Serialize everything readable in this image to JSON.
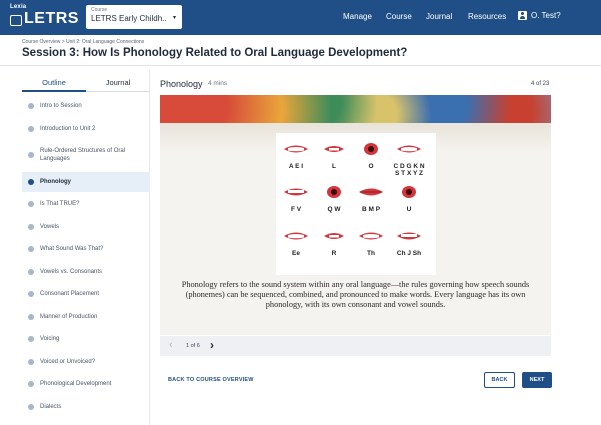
{
  "brand": {
    "small": "Lexia",
    "main": "LETRS"
  },
  "course_select": {
    "label": "Course",
    "value": "LETRS Early Childh...",
    "caret": "▾"
  },
  "nav": {
    "manage": "Manage",
    "course": "Course",
    "journal": "Journal",
    "resources": "Resources",
    "user": "O. Test?"
  },
  "breadcrumb": "Course Overview > Unit 2: Oral Language Connections",
  "page_title": "Session 3:  How Is Phonology Related to Oral Language Development?",
  "sidebar": {
    "tabs": {
      "outline": "Outline",
      "journal": "Journal"
    },
    "items": [
      {
        "label": "Intro to Session"
      },
      {
        "label": "Introduction to Unit 2"
      },
      {
        "label": "Rule-Ordered Structures of Oral Languages"
      },
      {
        "label": "Phonology"
      },
      {
        "label": "Is That TRUE?"
      },
      {
        "label": "Vowels"
      },
      {
        "label": "What Sound Was That?"
      },
      {
        "label": "Vowels vs. Consonants"
      },
      {
        "label": "Consonant Placement"
      },
      {
        "label": "Manner of Production"
      },
      {
        "label": "Voicing"
      },
      {
        "label": "Voiced or Unvoiced?"
      },
      {
        "label": "Phonological Development"
      },
      {
        "label": "Dialects"
      }
    ],
    "active_index": 3
  },
  "panel": {
    "title": "Phonology",
    "duration": "4 mins",
    "page": "4 of 23"
  },
  "slide": {
    "mouth_labels": [
      "A E I",
      "L",
      "O",
      "C D G K N\nS T X Y Z",
      "F V",
      "Q W",
      "B M P",
      "U",
      "Ee",
      "R",
      "Th",
      "Ch J Sh"
    ],
    "caption": "Phonology refers to the sound system within any oral language—the rules governing how speech sounds (phonemes) can be sequenced, combined, and pronounced to make words. Every language has its own phonology, with its own consonant and vowel sounds."
  },
  "pager": {
    "prev": "‹",
    "count": "1 of 6",
    "next": "›"
  },
  "footer": {
    "back_link": "BACK TO COURSE OVERVIEW",
    "back_button": "BACK",
    "next_button": "NEXT"
  },
  "colors": {
    "brand_blue": "#1f4f86",
    "lip_red": "#d3353d",
    "sidebar_dot": "#a7b7cb"
  }
}
